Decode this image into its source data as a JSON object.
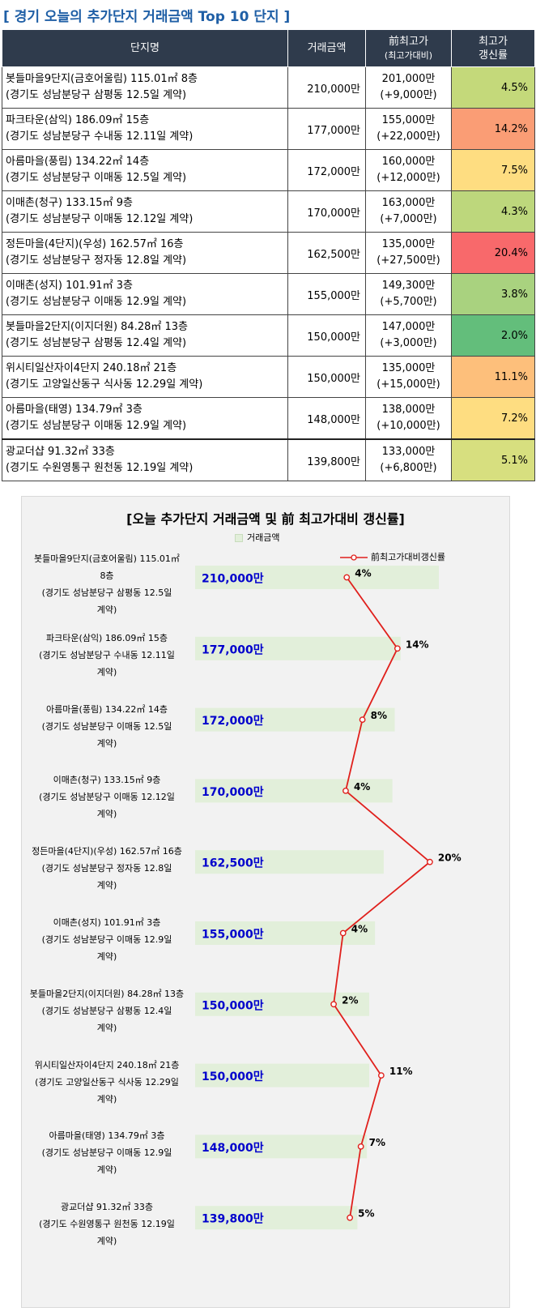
{
  "page_title": "[ 경기 오늘의 추가단지 거래금액 Top 10 단지 ]",
  "table": {
    "headers": {
      "name": "단지명",
      "price": "거래금액",
      "prev_line1": "前최고가",
      "prev_line2": "(최고가대비)",
      "rate_line1": "최고가",
      "rate_line2": "갱신률"
    },
    "rows": [
      {
        "name": "봇들마을9단지(금호어울림) 115.01㎡ 8층",
        "location": "(경기도 성남분당구 삼평동 12.5일 계약)",
        "price": "210,000만",
        "prev_high": "201,000만",
        "diff": "(+9,000만)",
        "rate": "4.5%",
        "rate_color": "#c4d97a"
      },
      {
        "name": "파크타운(삼익) 186.09㎡ 15층",
        "location": "(경기도 성남분당구 수내동 12.11일 계약)",
        "price": "177,000만",
        "prev_high": "155,000만",
        "diff": "(+22,000만)",
        "rate": "14.2%",
        "rate_color": "#fa9d75"
      },
      {
        "name": "아름마을(풍림) 134.22㎡ 14층",
        "location": "(경기도 성남분당구 이매동 12.5일 계약)",
        "price": "172,000만",
        "prev_high": "160,000만",
        "diff": "(+12,000만)",
        "rate": "7.5%",
        "rate_color": "#fedd81"
      },
      {
        "name": "이매촌(청구) 133.15㎡ 9층",
        "location": "(경기도 성남분당구 이매동 12.12일 계약)",
        "price": "170,000만",
        "prev_high": "163,000만",
        "diff": "(+7,000만)",
        "rate": "4.3%",
        "rate_color": "#bdd77c"
      },
      {
        "name": "정든마을(4단지)(우성) 162.57㎡ 16층",
        "location": "(경기도 성남분당구 정자동 12.8일 계약)",
        "price": "162,500만",
        "prev_high": "135,000만",
        "diff": "(+27,500만)",
        "rate": "20.4%",
        "rate_color": "#f8696b"
      },
      {
        "name": "이매촌(성지) 101.91㎡ 3층",
        "location": "(경기도 성남분당구 이매동 12.9일 계약)",
        "price": "155,000만",
        "prev_high": "149,300만",
        "diff": "(+5,700만)",
        "rate": "3.8%",
        "rate_color": "#a9d27f"
      },
      {
        "name": "봇들마을2단지(이지더원) 84.28㎡ 13층",
        "location": "(경기도 성남분당구 삼평동 12.4일 계약)",
        "price": "150,000만",
        "prev_high": "147,000만",
        "diff": "(+3,000만)",
        "rate": "2.0%",
        "rate_color": "#63be7b"
      },
      {
        "name": "위시티일산자이4단지 240.18㎡ 21층",
        "location": "(경기도 고양일산동구 식사동 12.29일 계약)",
        "price": "150,000만",
        "prev_high": "135,000만",
        "diff": "(+15,000만)",
        "rate": "11.1%",
        "rate_color": "#fdbf7b"
      },
      {
        "name": "아름마을(태영) 134.79㎡ 3층",
        "location": "(경기도 성남분당구 이매동 12.9일 계약)",
        "price": "148,000만",
        "prev_high": "138,000만",
        "diff": "(+10,000만)",
        "rate": "7.2%",
        "rate_color": "#fedd81"
      },
      {
        "name": "광교더샵 91.32㎡ 33층",
        "location": "(경기도 수원영통구 원천동 12.19일 계약)",
        "price": "139,800만",
        "prev_high": "133,000만",
        "diff": "(+6,800만)",
        "rate": "5.1%",
        "rate_color": "#d7df7f"
      }
    ]
  },
  "chart_data": {
    "type": "bar",
    "title": "[오늘 추가단지 거래금액 및 前 최고가대비 갱신률]",
    "legend": {
      "bar_series": "거래금액",
      "line_series": "前최고가대비갱신률"
    },
    "categories": [
      [
        "봇들마을9단지(금호어울림) 115.01㎡",
        "8층",
        "(경기도 성남분당구 삼평동 12.5일",
        "계약)"
      ],
      [
        "파크타운(삼익) 186.09㎡ 15층",
        "(경기도 성남분당구 수내동 12.11일",
        "계약)"
      ],
      [
        "아름마을(풍림) 134.22㎡ 14층",
        "(경기도 성남분당구 이매동 12.5일",
        "계약)"
      ],
      [
        "이매촌(청구) 133.15㎡ 9층",
        "(경기도 성남분당구 이매동 12.12일",
        "계약)"
      ],
      [
        "정든마을(4단지)(우성) 162.57㎡ 16층",
        "(경기도 성남분당구 정자동 12.8일",
        "계약)"
      ],
      [
        "이매촌(성지) 101.91㎡ 3층",
        "(경기도 성남분당구 이매동 12.9일",
        "계약)"
      ],
      [
        "봇들마을2단지(이지더원) 84.28㎡ 13층",
        "(경기도 성남분당구 삼평동 12.4일",
        "계약)"
      ],
      [
        "위시티일산자이4단지 240.18㎡ 21층",
        "(경기도 고양일산동구 식사동 12.29일",
        "계약)"
      ],
      [
        "아름마을(태영) 134.79㎡ 3층",
        "(경기도 성남분당구 이매동 12.9일",
        "계약)"
      ],
      [
        "광교더샵 91.32㎡ 33층",
        "(경기도 수원영통구 원천동 12.19일",
        "계약)"
      ]
    ],
    "series": [
      {
        "name": "거래금액",
        "kind": "bar",
        "values": [
          210000,
          177000,
          172000,
          170000,
          162500,
          155000,
          150000,
          150000,
          148000,
          139800
        ],
        "labels": [
          "210,000만",
          "177,000만",
          "172,000만",
          "170,000만",
          "162,500만",
          "155,000만",
          "150,000만",
          "150,000만",
          "148,000만",
          "139,800만"
        ],
        "color": "#e2efda",
        "label_color": "#0000cc"
      },
      {
        "name": "前최고가대비갱신률",
        "kind": "line",
        "values": [
          4.5,
          14.2,
          7.5,
          4.3,
          20.4,
          3.8,
          2.0,
          11.1,
          7.2,
          5.1
        ],
        "labels": [
          "4%",
          "14%",
          "8%",
          "4%",
          "20%",
          "4%",
          "2%",
          "11%",
          "7%",
          "5%"
        ],
        "color": "#e0201c"
      }
    ],
    "bar_range": [
      0,
      210000
    ],
    "line_range": [
      -24.5,
      26.3
    ],
    "orientation": "horizontal",
    "grid": false,
    "legend_placement": "top"
  }
}
